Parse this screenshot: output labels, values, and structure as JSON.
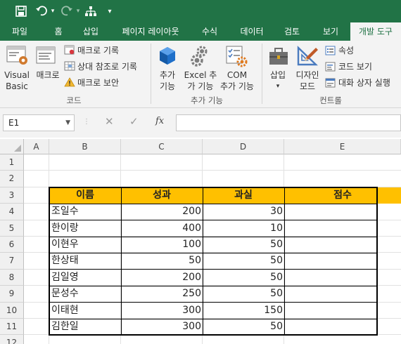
{
  "quick_access": {
    "save_icon": "save-icon",
    "undo_icon": "undo-icon",
    "redo_icon": "redo-icon",
    "tree_icon": "structure-icon",
    "customize_icon": "customize-dropdown-icon"
  },
  "tabs": [
    "파일",
    "홈",
    "삽입",
    "페이지 레이아웃",
    "수식",
    "데이터",
    "검토",
    "보기",
    "개발 도구"
  ],
  "active_tab": "개발 도구",
  "ribbon": {
    "code": {
      "visual_basic_line1": "Visual",
      "visual_basic_line2": "Basic",
      "macro": "매크로",
      "record_macro": "매크로 기록",
      "relative_ref": "상대 참조로 기록",
      "macro_security": "매크로 보안",
      "group_label": "코드"
    },
    "addins": {
      "addins_line1": "추가",
      "addins_line2": "기능",
      "excel_addins_line1": "Excel 추",
      "excel_addins_line2": "가 기능",
      "com_addins_line1": "COM",
      "com_addins_line2": "추가 기능",
      "group_label": "추가 기능"
    },
    "controls": {
      "insert": "삽입",
      "design_mode_line1": "디자인",
      "design_mode_line2": "모드",
      "properties": "속성",
      "view_code": "코드 보기",
      "run_dialog": "대화 상자 실행",
      "group_label": "컨트롤"
    }
  },
  "formula_bar": {
    "name_box": "E1",
    "cancel_symbol": "✕",
    "enter_symbol": "✓",
    "fx_label": "fx",
    "formula": ""
  },
  "sheet": {
    "columns": [
      "A",
      "B",
      "C",
      "D",
      "E"
    ],
    "rows": [
      "1",
      "2",
      "3",
      "4",
      "5",
      "6",
      "7",
      "8",
      "9",
      "10",
      "11",
      "12"
    ],
    "table_headers": [
      "이름",
      "성과",
      "과실",
      "점수"
    ],
    "table_rows": [
      [
        "조일수",
        "200",
        "30",
        ""
      ],
      [
        "한이랑",
        "400",
        "10",
        ""
      ],
      [
        "이현우",
        "100",
        "50",
        ""
      ],
      [
        "한상태",
        "50",
        "50",
        ""
      ],
      [
        "김일영",
        "200",
        "50",
        ""
      ],
      [
        "문성수",
        "250",
        "50",
        ""
      ],
      [
        "이태현",
        "300",
        "150",
        ""
      ],
      [
        "김한일",
        "300",
        "50",
        ""
      ]
    ],
    "header_fill": "#ffc000"
  },
  "colors": {
    "accent": "#217346",
    "ribbon_bg": "#f3f3f3"
  }
}
